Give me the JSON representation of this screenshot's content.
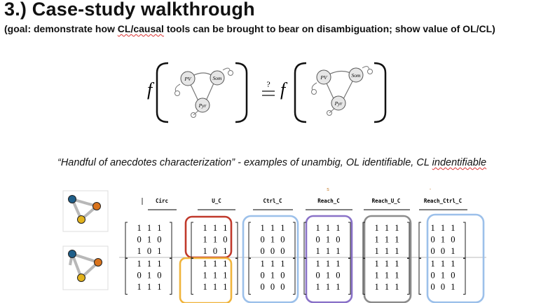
{
  "slide": {
    "title": "3.) Case-study walkthrough",
    "subtitle_plain": "(goal: demonstrate how ",
    "subtitle_squig": "CL/causal",
    "subtitle_rest": " tools can be brought to bear on disambiguation; show value of OL/CL)",
    "caption_main": "“Handful of anecdotes characterization” - examples of unambig, OL identifiable, CL ",
    "caption_squig": "indentifiable"
  },
  "equation": {
    "func": "f",
    "relation": "?",
    "nodes": [
      "PV",
      "Som",
      "Pyr"
    ]
  },
  "table": {
    "headers": [
      "Circ",
      "U_C",
      "Ctrl_C",
      "Reach_C",
      "Reach_U_C",
      "Reach_Ctrl_C"
    ],
    "stray_marks": [
      "s",
      "-"
    ],
    "rows": [
      [
        [
          "1 1 1",
          "0 1 0",
          "1 0 1"
        ],
        [
          "1 1 1",
          "1 1 0",
          "1 0 1"
        ],
        [
          "1 1 1",
          "0 1 0",
          "0 0 0"
        ],
        [
          "1 1 1",
          "0 1 0",
          "1 1 1"
        ],
        [
          "1 1 1",
          "1 1 1",
          "1 1 1"
        ],
        [
          "1 1 1",
          "0 1 0",
          "0 0 1"
        ]
      ],
      [
        [
          "1 1 1",
          "0 1 0",
          "1 1 1"
        ],
        [
          "1 1 1",
          "1 1 1",
          "1 1 1"
        ],
        [
          "1 1 1",
          "0 1 0",
          "0 0 0"
        ],
        [
          "1 1 1",
          "0 1 0",
          "1 1 1"
        ],
        [
          "1 1 1",
          "1 1 1",
          "1 1 1"
        ],
        [
          "1 1 1",
          "0 1 0",
          "0 0 1"
        ]
      ]
    ]
  },
  "colors": {
    "red": "#c0392b",
    "orange": "#f0b43c",
    "blue": "#9cc0ea",
    "purple": "#8a72c8",
    "gray": "#8c8c8c",
    "teal_node": "#1f5f8a",
    "orange_node": "#d9731c",
    "yellow_node": "#e2b21c"
  }
}
